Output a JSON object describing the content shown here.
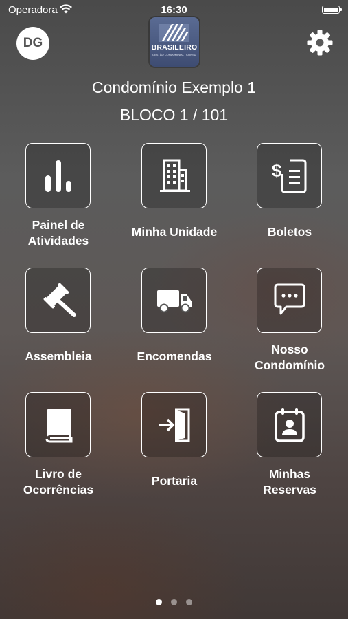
{
  "status_bar": {
    "carrier": "Operadora",
    "time": "16:30",
    "battery_level": 1.0
  },
  "header": {
    "avatar_initials": "DG",
    "logo_text": "BRASILEIRO",
    "logo_tagline": "GESTÃO CONDOMINIAL | CONSULTORIA"
  },
  "condo": {
    "name": "Condomínio Exemplo 1",
    "unit": "BLOCO 1 / 101"
  },
  "tiles": [
    {
      "label": "Painel de\nAtividades",
      "icon": "bar-chart-icon"
    },
    {
      "label": "Minha Unidade",
      "icon": "building-icon"
    },
    {
      "label": "Boletos",
      "icon": "invoice-icon"
    },
    {
      "label": "Assembleia",
      "icon": "gavel-icon"
    },
    {
      "label": "Encomendas",
      "icon": "truck-icon"
    },
    {
      "label": "Nosso\nCondomínio",
      "icon": "chat-icon"
    },
    {
      "label": "Livro de\nOcorrências",
      "icon": "book-icon"
    },
    {
      "label": "Portaria",
      "icon": "enter-door-icon"
    },
    {
      "label": "Minhas\nReservas",
      "icon": "calendar-person-icon"
    }
  ],
  "pagination": {
    "pages": 3,
    "current": 1
  }
}
